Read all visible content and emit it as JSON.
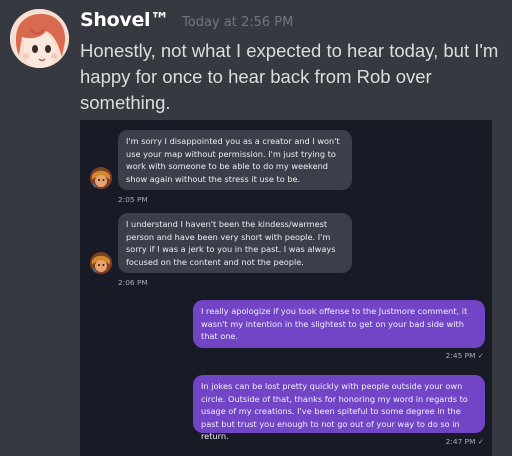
{
  "message": {
    "username": "Shovel™",
    "timestamp": "Today at 2:56 PM",
    "text": "Honestly, not what I expected to hear today, but I'm happy for once to hear back from Rob over something."
  },
  "chat": {
    "messages": [
      {
        "direction": "received",
        "text": "I'm sorry I disappointed you as a creator and I won't use your map without permission. I'm just trying to work with someone to be able to do my weekend show again without the stress it use to be.",
        "time": "2:05 PM"
      },
      {
        "direction": "received",
        "text": "I understand I haven't been the kindess/warmest person and have been very short with people. I'm sorry if I was a jerk to you in the past. I was always focused on the content and not the people.",
        "time": "2:06 PM"
      },
      {
        "direction": "sent",
        "text": "I really apologize if you took offense to the Justmore comment, it wasn't my intention in the slightest to get on your bad side with that one.",
        "time": "2:45 PM ✓"
      },
      {
        "direction": "sent",
        "text": "In jokes can be lost pretty quickly with people outside your own circle. Outside of that, thanks for honoring my word in regards to usage of my creations. I've been spiteful to some degree in the past but trust you enough to not go out of your way to do so in return.",
        "time": "2:47 PM ✓"
      }
    ]
  },
  "colors": {
    "background": "#36393f",
    "attachment_bg": "#181b25",
    "received_bubble": "#3a3f4b",
    "sent_bubble": "#7145c6"
  }
}
